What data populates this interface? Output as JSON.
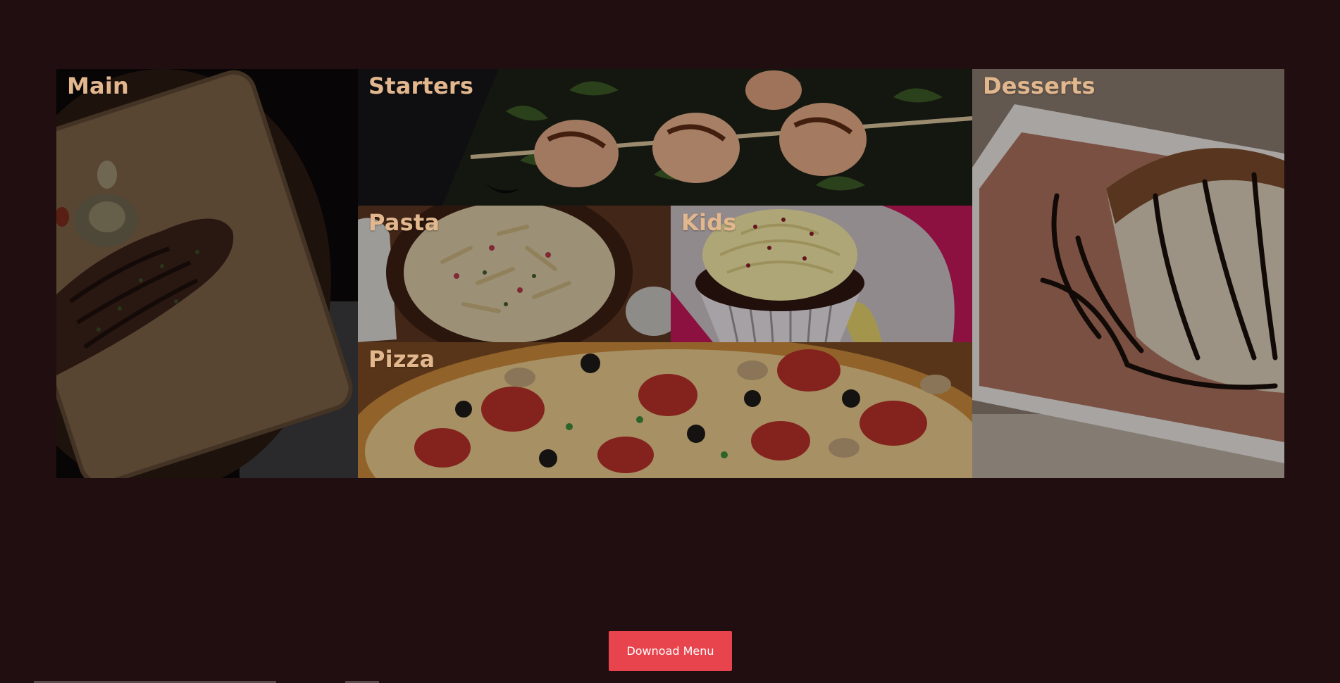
{
  "colors": {
    "background": "#200e10",
    "tile_label": "#e2b78e",
    "button_bg": "#e8444d",
    "button_text": "#ffffff"
  },
  "menu": {
    "categories": [
      {
        "key": "main",
        "label": "Main",
        "photo": "steak-on-board"
      },
      {
        "key": "starters",
        "label": "Starters",
        "photo": "shrimp-skewers"
      },
      {
        "key": "pasta",
        "label": "Pasta",
        "photo": "pasta-bowl"
      },
      {
        "key": "kids",
        "label": "Kids",
        "photo": "cupcake"
      },
      {
        "key": "pizza",
        "label": "Pizza",
        "photo": "pepperoni-pizza"
      },
      {
        "key": "desserts",
        "label": "Desserts",
        "photo": "tiramisu-slice"
      }
    ]
  },
  "download": {
    "label": "Downoad Menu"
  }
}
